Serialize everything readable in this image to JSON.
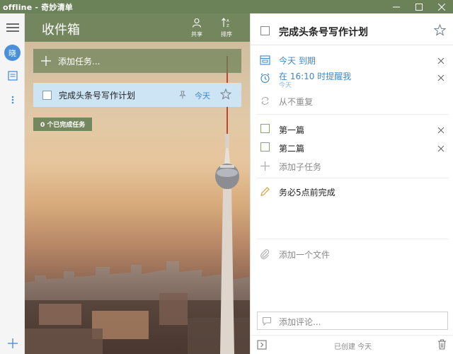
{
  "window": {
    "title": "offline - 奇妙清单"
  },
  "rail": {
    "avatar_text": "晓"
  },
  "list": {
    "title": "收件箱",
    "share_label": "共享",
    "sort_label": "排序",
    "add_task_placeholder": "添加任务...",
    "tasks": [
      {
        "title": "完成头条号写作计划",
        "due": "今天",
        "starred": false
      }
    ],
    "completed_label": "0 个已完成任务"
  },
  "detail": {
    "task_title": "完成头条号写作计划",
    "due_text": "今天 到期",
    "reminder_text": "在 16:10 时提醒我",
    "reminder_sub": "今天",
    "repeat_text": "从不重复",
    "subtasks": [
      {
        "title": "第一篇"
      },
      {
        "title": "第二篇"
      }
    ],
    "add_subtask": "添加子任务",
    "note": "务必5点前完成",
    "add_file": "添加一个文件",
    "comment_placeholder": "添加评论...",
    "created_text": "已创建 今天"
  },
  "colors": {
    "accent_green": "#6b8158",
    "accent_blue": "#3d87c8",
    "selected_row": "#cde4f5",
    "subtask_check": "#8aab4f",
    "note_pencil": "#e8a33a"
  }
}
